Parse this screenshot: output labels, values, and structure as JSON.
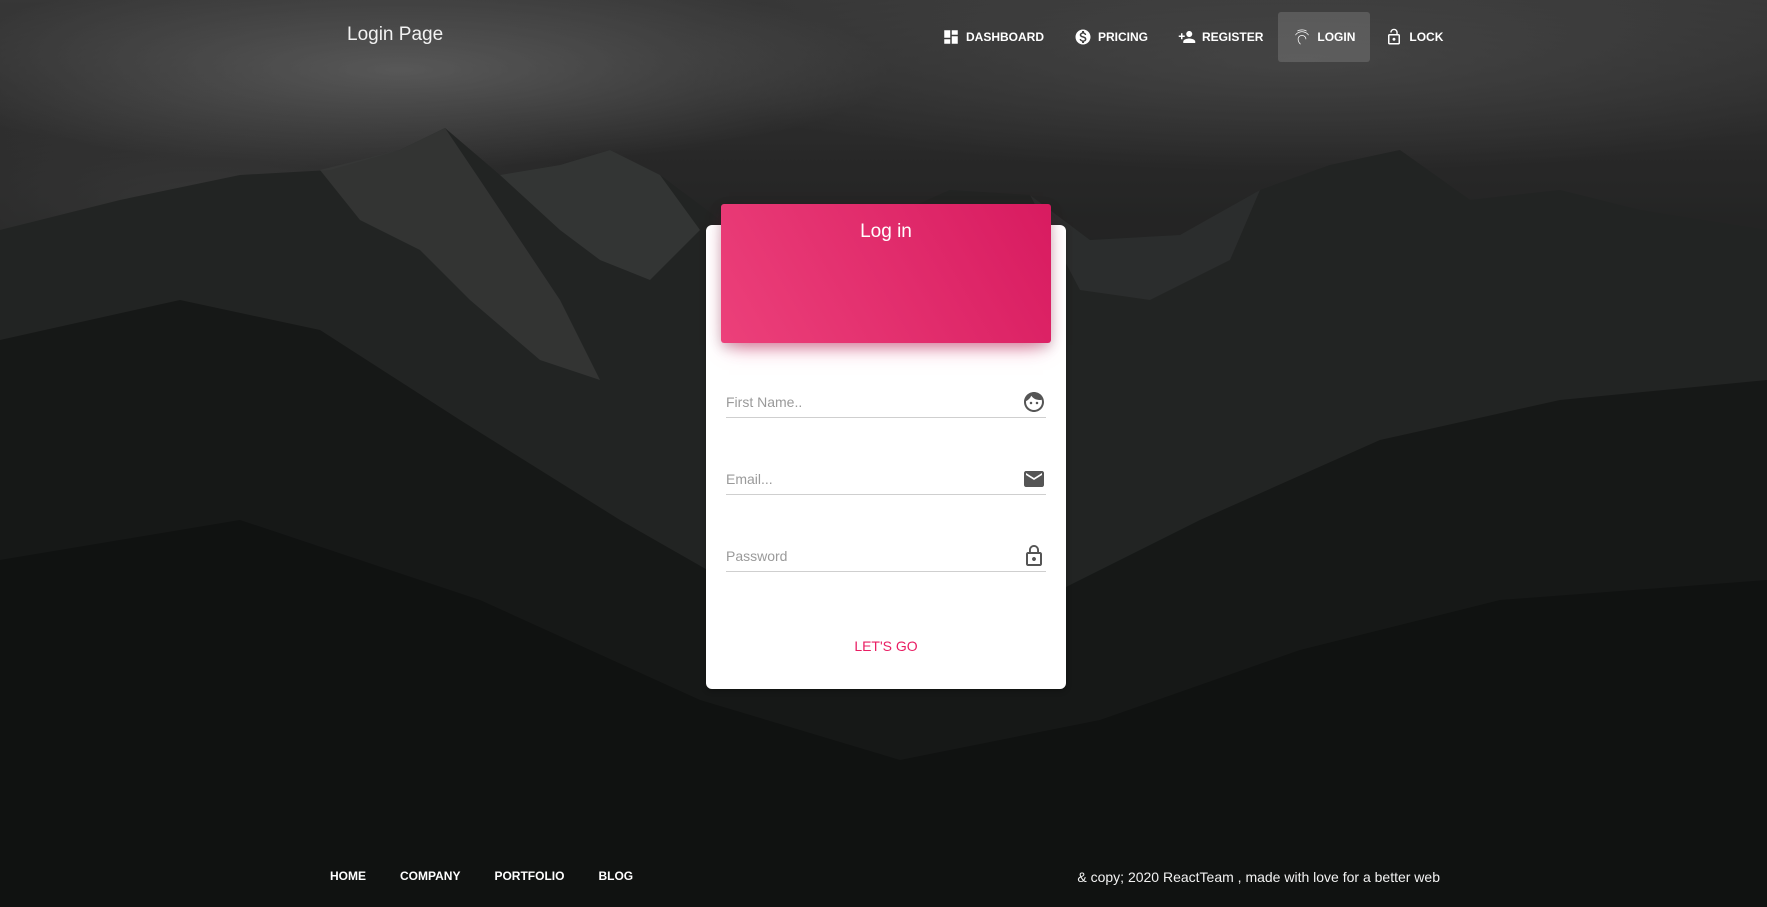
{
  "navbar": {
    "brand": "Login Page",
    "items": [
      {
        "label": "Dashboard",
        "icon": "dashboard-icon"
      },
      {
        "label": "Pricing",
        "icon": "dollar-icon"
      },
      {
        "label": "Register",
        "icon": "person-add-icon"
      },
      {
        "label": "Login",
        "icon": "fingerprint-icon",
        "active": true
      },
      {
        "label": "Lock",
        "icon": "lock-open-icon"
      }
    ]
  },
  "card": {
    "title": "Log in",
    "fields": [
      {
        "placeholder": "First Name..",
        "value": "",
        "icon": "face-icon"
      },
      {
        "placeholder": "Email...",
        "value": "",
        "icon": "email-icon"
      },
      {
        "placeholder": "Password",
        "value": "",
        "icon": "lock-outline-icon"
      }
    ],
    "submit_label": "Let's Go"
  },
  "footer": {
    "links": [
      "Home",
      "Company",
      "Portfolio",
      "Blog"
    ],
    "copyright": "& copy; 2020 ReactTeam , made with love for a better web"
  },
  "colors": {
    "accent": "#e91e63",
    "header_gradient_start": "#ec407a",
    "header_gradient_end": "#d81b60"
  }
}
